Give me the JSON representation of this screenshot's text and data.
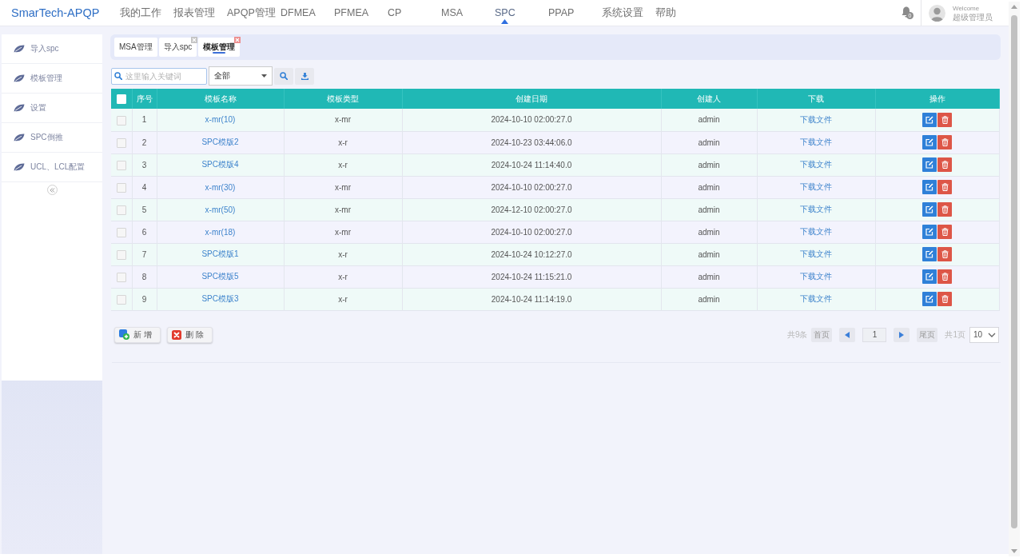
{
  "header": {
    "logo": "SmarTech-APQP",
    "nav": [
      {
        "label": "我的工作",
        "selected": false
      },
      {
        "label": "报表管理",
        "selected": false
      },
      {
        "label": "APQP管理",
        "selected": false
      },
      {
        "label": "DFMEA",
        "selected": false
      },
      {
        "label": "PFMEA",
        "selected": false
      },
      {
        "label": "CP",
        "selected": false
      },
      {
        "label": "MSA",
        "selected": false
      },
      {
        "label": "SPC",
        "selected": true
      },
      {
        "label": "PPAP",
        "selected": false
      },
      {
        "label": "系统设置",
        "selected": false
      },
      {
        "label": "帮助",
        "selected": false
      }
    ],
    "notifications": "0",
    "user": {
      "greeting": "Welcome",
      "name": "超级管理员"
    }
  },
  "sidebar": {
    "items": [
      {
        "label": "导入spc"
      },
      {
        "label": "模板管理"
      },
      {
        "label": "设置"
      },
      {
        "label": "SPC倒推"
      },
      {
        "label": "UCL、LCL配置"
      }
    ]
  },
  "tabs": [
    {
      "label": "MSA管理",
      "selected": false,
      "closable": false
    },
    {
      "label": "导入spc",
      "selected": false,
      "closable": true
    },
    {
      "label": "模板管理",
      "selected": true,
      "closable": true
    }
  ],
  "toolbar": {
    "search": {
      "placeholder": "这里输入关键词"
    },
    "filter": {
      "value": "全部"
    }
  },
  "table": {
    "all_checked": false,
    "columns": [
      "序号",
      "模板名称",
      "模板类型",
      "创建日期",
      "创建人",
      "下载",
      "操作"
    ],
    "rows": [
      {
        "checked": false,
        "index": "1",
        "name": "x-mr(10)",
        "type": "x-mr",
        "created": "2024-10-10 02:00:27.0",
        "creator": "admin",
        "download": "下载文件"
      },
      {
        "checked": false,
        "index": "2",
        "name": "SPC模版2",
        "type": "x-r",
        "created": "2024-10-23 03:44:06.0",
        "creator": "admin",
        "download": "下载文件"
      },
      {
        "checked": false,
        "index": "3",
        "name": "SPC模版4",
        "type": "x-r",
        "created": "2024-10-24 11:14:40.0",
        "creator": "admin",
        "download": "下载文件"
      },
      {
        "checked": false,
        "index": "4",
        "name": "x-mr(30)",
        "type": "x-mr",
        "created": "2024-10-10 02:00:27.0",
        "creator": "admin",
        "download": "下载文件"
      },
      {
        "checked": false,
        "index": "5",
        "name": "x-mr(50)",
        "type": "x-mr",
        "created": "2024-12-10 02:00:27.0",
        "creator": "admin",
        "download": "下载文件"
      },
      {
        "checked": false,
        "index": "6",
        "name": "x-mr(18)",
        "type": "x-mr",
        "created": "2024-10-10 02:00:27.0",
        "creator": "admin",
        "download": "下载文件"
      },
      {
        "checked": false,
        "index": "7",
        "name": "SPC模版1",
        "type": "x-r",
        "created": "2024-10-24 10:12:27.0",
        "creator": "admin",
        "download": "下载文件"
      },
      {
        "checked": false,
        "index": "8",
        "name": "SPC模版5",
        "type": "x-r",
        "created": "2024-10-24 11:15:21.0",
        "creator": "admin",
        "download": "下载文件"
      },
      {
        "checked": false,
        "index": "9",
        "name": "SPC模版3",
        "type": "x-r",
        "created": "2024-10-24 11:14:19.0",
        "creator": "admin",
        "download": "下载文件"
      }
    ]
  },
  "actions": [
    {
      "kind": "add",
      "label": "新增"
    },
    {
      "kind": "delete",
      "label": "删除"
    }
  ],
  "pagination": {
    "total": "共9条",
    "first": "首页",
    "page": "1",
    "last": "尾页",
    "pages": "共1页",
    "page_size": "10"
  }
}
